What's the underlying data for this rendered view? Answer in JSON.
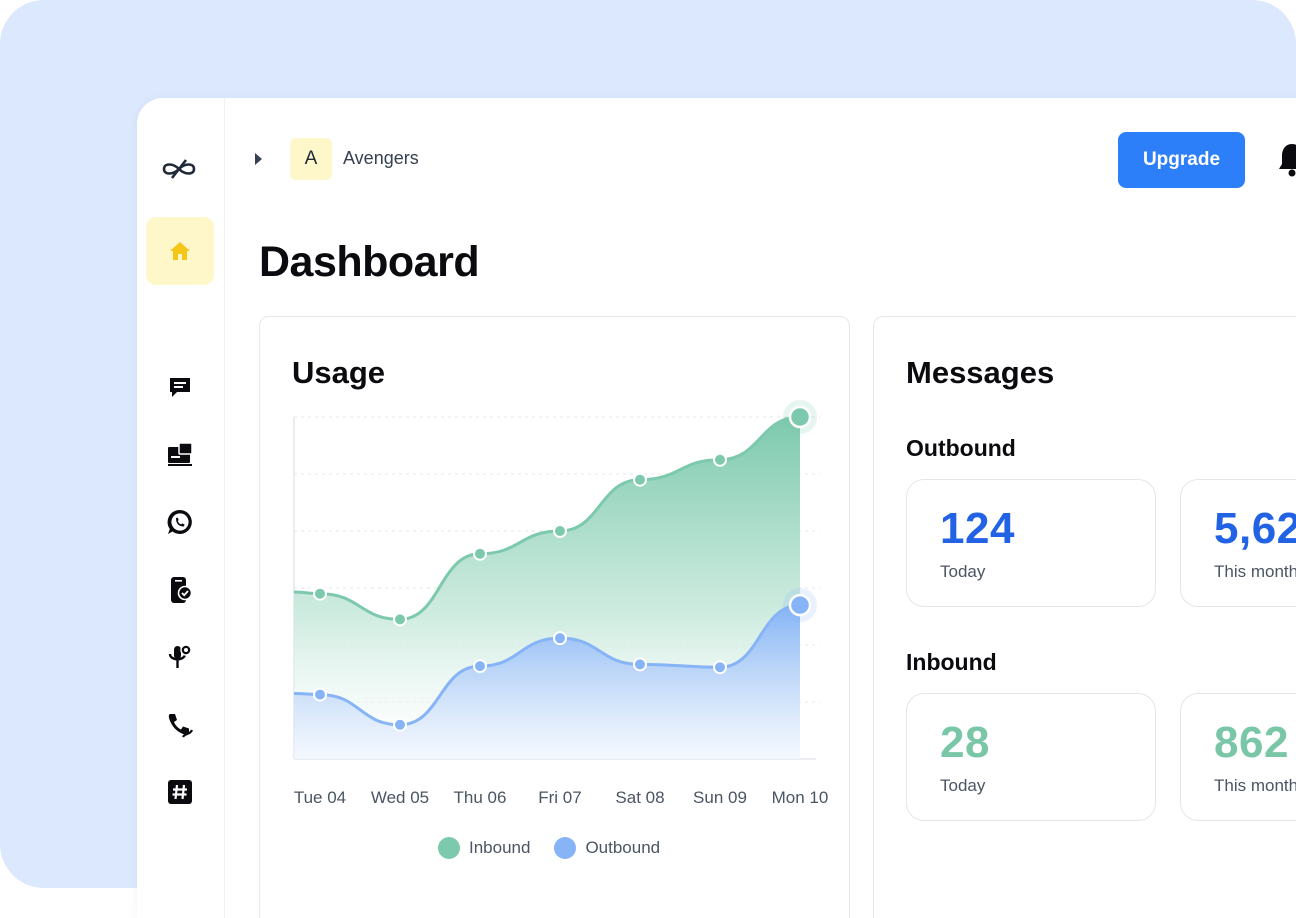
{
  "workspace": {
    "initial": "A",
    "name": "Avengers",
    "avatar_bg": "#fdf7c9"
  },
  "header": {
    "upgrade_label": "Upgrade",
    "upgrade_color": "#2d7ff9"
  },
  "page": {
    "title": "Dashboard"
  },
  "sidebar": {
    "items": [
      {
        "icon": "logo-icon"
      },
      {
        "icon": "home-icon",
        "active": true
      },
      {
        "icon": "chat-icon"
      },
      {
        "icon": "inbox-icon"
      },
      {
        "icon": "whatsapp-icon"
      },
      {
        "icon": "phone-verify-icon"
      },
      {
        "icon": "voice-icon"
      },
      {
        "icon": "call-forward-icon"
      },
      {
        "icon": "hashtag-icon"
      }
    ]
  },
  "usage": {
    "title": "Usage",
    "chart_data": {
      "type": "area",
      "categories": [
        "Tue 04",
        "Wed 05",
        "Thu 06",
        "Fri 07",
        "Sat 08",
        "Sun 09",
        "Mon 10"
      ],
      "ylim": [
        0,
        6
      ],
      "grid": true,
      "legend": "bottom",
      "series": [
        {
          "name": "Inbound",
          "color": "#7cc9ad",
          "values": [
            2.9,
            2.45,
            3.6,
            4.0,
            4.9,
            5.25,
            6.0
          ]
        },
        {
          "name": "Outbound",
          "color": "#86b4f7",
          "values": [
            1.13,
            0.6,
            1.63,
            2.12,
            1.66,
            1.61,
            2.7
          ]
        }
      ]
    }
  },
  "messages": {
    "title": "Messages",
    "outbound": {
      "label": "Outbound",
      "today_value": "124",
      "today_caption": "Today",
      "month_value": "5,62",
      "month_caption": "This month"
    },
    "inbound": {
      "label": "Inbound",
      "today_value": "28",
      "today_caption": "Today",
      "month_value": "862",
      "month_caption": "This month"
    }
  }
}
